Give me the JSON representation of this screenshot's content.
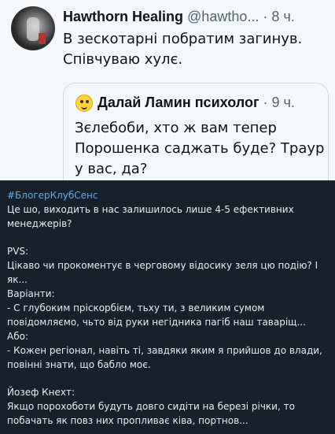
{
  "tweet": {
    "author_name": "Hawthorn Healing",
    "author_handle": "@hawtho...",
    "time": "· 8 ч.",
    "text_line1": "В зескотарні побратим загинув.",
    "text_line2": "Співчуваю хулє."
  },
  "quote": {
    "author_name": "Далай Ламин психолог",
    "time": "· 9 ч.",
    "text_line1": "Зєлебоби, хто ж вам тепер",
    "text_line2": "Порошенка саджать буде? Траур",
    "text_line3": "у вас, да?"
  },
  "post": {
    "hashtag": "#БлогерКлубСенс",
    "line1": "Це шо, виходить в нас залишилось лише 4-5 ефективних",
    "line2": "менеджерів?",
    "line3": "PVS:",
    "line4": "Цікаво чи прокоментує в черговому відосику зеля цю подію? І",
    "line5": "як...",
    "line6": "Варіанти:",
    "line7": "- С глубоким пріскорбієм, тьху ти, з великим сумом",
    "line8": "повідомляємо, чьто від руки негідника пагіб наш таваріщ...",
    "line9": "Або:",
    "line10": "- Кожен регіонал, навіть ті, завдяки яким я прийшов до влади,",
    "line11": "повінні знати, що бабло моє.",
    "line12": "Йозеф Кнехт:",
    "line13": "Якщо порохоботи будуть довго сидіти на березі річки, то",
    "line14": "побачать як повз них пропливає ківа, портнов..."
  }
}
